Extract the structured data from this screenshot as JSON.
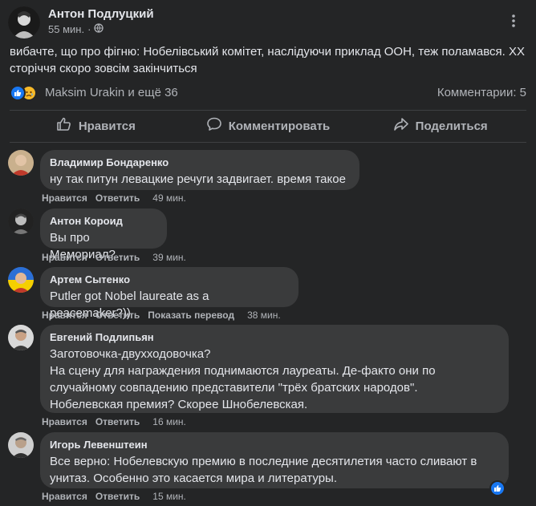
{
  "post": {
    "author": "Антон Подлуцкий",
    "time": "55 мин.",
    "text": "вибачте, що про фігню: Нобелівський комітет, наслідуючи приклад ООН, теж поламався. XX сторіччя скоро зовсім закінчиться",
    "reactions_text": "Maksim Urakin и ещё 36",
    "comments_count": "Комментарии: 5",
    "actions": {
      "like": "Нравится",
      "comment": "Комментировать",
      "share": "Поделиться"
    }
  },
  "comments": [
    {
      "author": "Владимир Бондаренко",
      "text": "ну так питун левацкие речуги задвигает. время такое",
      "like_label": "Нравится",
      "reply_label": "Ответить",
      "time": "49 мин."
    },
    {
      "author": "Антон Короид",
      "text": "Вы про Мемориал?",
      "like_label": "Нравится",
      "reply_label": "Ответить",
      "time": "39 мин."
    },
    {
      "author": "Артем Сытенко",
      "text": "Putler got Nobel laureate as a peacemaker?))",
      "like_label": "Нравится",
      "reply_label": "Ответить",
      "translate_label": "Показать перевод",
      "time": "38 мин."
    },
    {
      "author": "Евгений Подлипьян",
      "text_lines": [
        "Заготовочка-двухходовочка?",
        "На сцену для награждения поднимаются лауреаты. Де-факто они по",
        "случайному совпадению представители \"трёх братских народов\".",
        "Нобелевская премия? Скорее Шнобелевская."
      ],
      "like_label": "Нравится",
      "reply_label": "Ответить",
      "time": "16 мин."
    },
    {
      "author": "Игорь Левенштеин",
      "text_lines": [
        "Все верно: Нобелевскую премию в последние десятилетия часто сливают в",
        "унитаз. Особенно это касается мира и литературы."
      ],
      "like_label": "Нравится",
      "reply_label": "Ответить",
      "time": "15 мин."
    }
  ],
  "colors": {
    "background": "#242526",
    "bubble": "#3a3b3c",
    "primary_text": "#e4e6eb",
    "secondary_text": "#b0b3b8",
    "like_blue": "#1877f2",
    "sad_yellow": "#f7b928"
  },
  "icons": [
    "globe-icon",
    "more-options-icon",
    "like-reaction-icon",
    "sad-reaction-icon",
    "thumbs-up-icon",
    "comment-icon",
    "share-icon"
  ]
}
